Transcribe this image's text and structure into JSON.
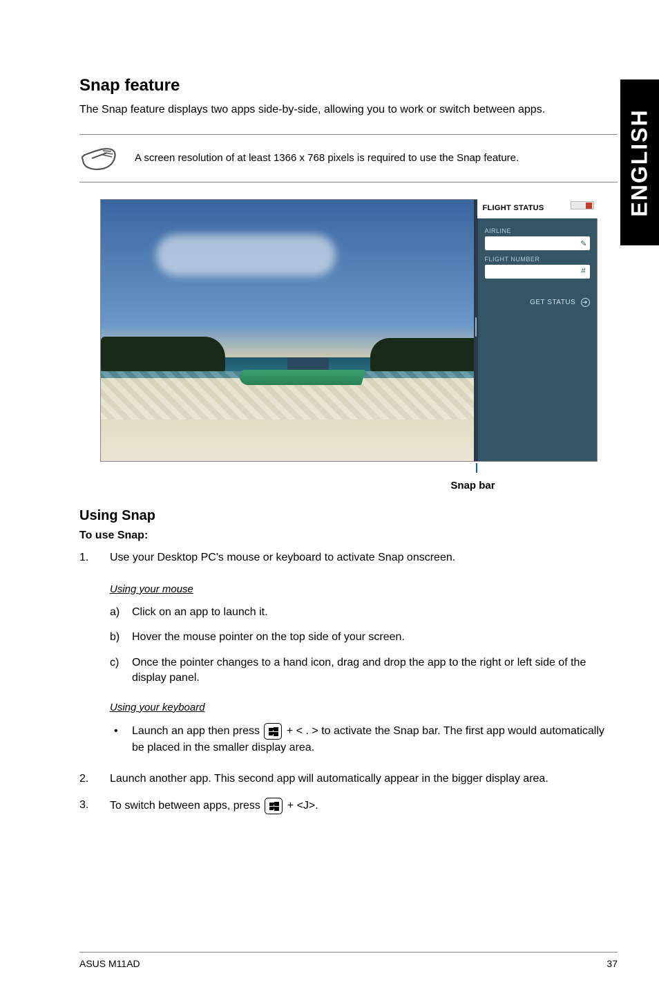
{
  "sideTab": "ENGLISH",
  "heading": "Snap feature",
  "intro": "The Snap feature displays two apps side-by-side, allowing you to work or switch between apps.",
  "note": "A screen resolution of at least 1366 x 768 pixels is required to use the Snap feature.",
  "snapScreenshot": {
    "appTitle": "FLIGHT STATUS",
    "label1": "AIRLINE",
    "label2": "FLIGHT NUMBER",
    "statusBtn": "GET STATUS"
  },
  "snapBarLabel": "Snap bar",
  "usingHeading": "Using Snap",
  "toUse": "To use Snap:",
  "step1": "Use your Desktop PC's mouse or keyboard to activate Snap onscreen.",
  "mouseHead": "Using your mouse",
  "mouse": {
    "a": "Click on an app to launch it.",
    "b": "Hover the mouse pointer on the top side of your screen.",
    "c": "Once the pointer changes to a hand icon, drag and drop the app to the right or left side of the display panel."
  },
  "kbHead": "Using your keyboard",
  "kbBulletPre": "Launch an app then press ",
  "kbBulletMid": " + < . > to activate the Snap bar. The first app would automatically be placed in the smaller display area.",
  "step2": "Launch another app. This second app will automatically appear in the bigger display area.",
  "step3pre": "To switch between apps, press ",
  "step3post": " + <J>.",
  "footerLeft": "ASUS M11AD",
  "footerRight": "37"
}
